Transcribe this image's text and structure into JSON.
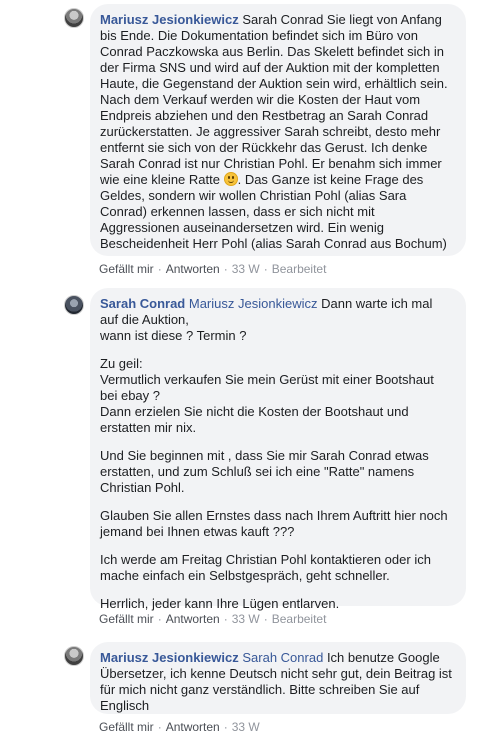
{
  "comments": [
    {
      "author": "Mariusz Jesionkiewicz",
      "text_1": "Sarah Conrad Sie liegt von Anfang bis Ende. Die Dokumentation befindet sich im Büro von Conrad Paczkowska aus Berlin. Das Skelett befindet sich in der Firma SNS und wird auf der Auktion mit der kompletten Haute, die Gegenstand der Auktion sein wird, erhältlich sein. Nach dem Verkauf werden wir die Kosten der Haut vom Endpreis abziehen und den Restbetrag an Sarah Conrad zurückerstatten. Je aggressiver Sarah schreibt, desto mehr entfernt sie sich von der Rückkehr das Gerust. Ich denke Sarah Conrad ist nur Christian Pohl. Er benahm sich immer wie eine kleine Ratte",
      "text_2": ". Das Ganze ist keine Frage des Geldes, sondern wir wollen Christian Pohl (alias Sara Conrad) erkennen lassen, dass er sich nicht mit Aggressionen auseinandersetzen wird. Ein wenig Bescheidenheit Herr Pohl (alias Sarah Conrad aus Bochum)",
      "like": "Gefällt mir",
      "reply": "Antworten",
      "time": "33 W",
      "edited": "Bearbeitet"
    },
    {
      "author": "Sarah Conrad",
      "mention": "Mariusz Jesionkiewicz",
      "paragraphs": [
        "Dann warte ich mal auf die Auktion,\nwann ist diese ? Termin ?",
        "Zu geil:\nVermutlich verkaufen Sie mein Gerüst mit einer Bootshaut bei ebay ?\nDann erzielen Sie nicht die Kosten der Bootshaut und erstatten mir nix.",
        "Und Sie beginnen mit , dass Sie mir Sarah Conrad etwas erstatten, und zum Schluß sei ich eine \"Ratte\" namens Christian Pohl.",
        "Glauben Sie allen Ernstes dass nach Ihrem Auftritt hier noch jemand bei Ihnen etwas kauft ???",
        "Ich werde am Freitag Christian Pohl kontaktieren oder ich mache einfach ein Selbstgespräch, geht schneller.",
        "Herrlich, jeder kann Ihre Lügen entlarven."
      ],
      "like": "Gefällt mir",
      "reply": "Antworten",
      "time": "33 W",
      "edited": "Bearbeitet"
    },
    {
      "author": "Mariusz Jesionkiewicz",
      "mention": "Sarah Conrad",
      "text": "Ich benutze Google Übersetzer, ich kenne Deutsch nicht sehr gut, dein Beitrag ist für mich nicht ganz verständlich. Bitte schreiben Sie auf Englisch",
      "like": "Gefällt mir",
      "reply": "Antworten",
      "time": "33 W"
    }
  ],
  "separator": "·",
  "icons": {
    "emoji": "smiling-face-emoji"
  }
}
